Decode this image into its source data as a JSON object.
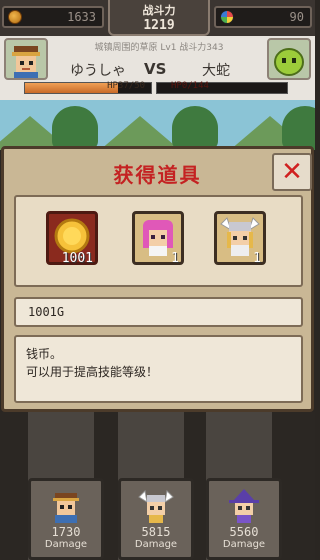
{
  "hud": {
    "gold_value": "1633",
    "gem_value": "90",
    "power_label": "战斗力",
    "power_value": "1219"
  },
  "battle": {
    "stage_text": "城镇周围的草原 Lv1 战斗力343",
    "hero_name": "ゆうしゃ",
    "vs_label": "VS",
    "enemy_name": "大蛇",
    "hero_hp_text": "HP37/50",
    "hero_hp_ratio": 0.74,
    "enemy_hp_text": "HP0/144",
    "enemy_hp_ratio": 0.0
  },
  "modal": {
    "title": "获得道具",
    "close_icon": "close-icon",
    "items": [
      {
        "name": "gold-coin",
        "icon": "gold-coin-icon",
        "count": "1001",
        "selected": true
      },
      {
        "name": "pink-hair-character",
        "icon": "pink-hair-character-icon",
        "count": "1",
        "selected": false
      },
      {
        "name": "winged-helmet-character",
        "icon": "winged-helmet-character-icon",
        "count": "1",
        "selected": false
      }
    ],
    "amount": "1001G",
    "description_line1": "钱币。",
    "description_line2": "可以用于提高技能等级！"
  },
  "party": [
    {
      "name": "hero",
      "damage": "1730",
      "label": "Damage"
    },
    {
      "name": "valkyrie",
      "damage": "5815",
      "label": "Damage"
    },
    {
      "name": "witch",
      "damage": "5560",
      "label": "Damage"
    }
  ],
  "colors": {
    "title_red": "#c42222",
    "panel_bg": "#c9b795",
    "selected_item_bg": "#8a2a1e"
  }
}
